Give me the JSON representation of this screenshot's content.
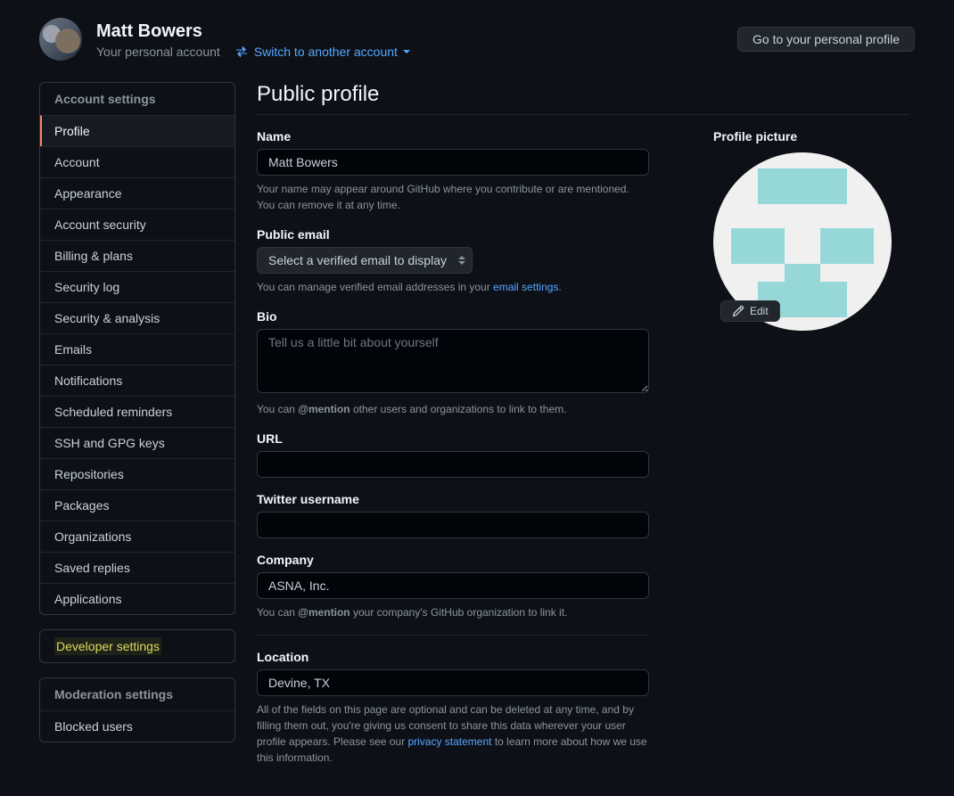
{
  "header": {
    "username": "Matt Bowers",
    "subtitle": "Your personal account",
    "switch_label": "Switch to another account",
    "go_profile_label": "Go to your personal profile"
  },
  "sidebar": {
    "account_settings_header": "Account settings",
    "items": [
      {
        "label": "Profile",
        "active": true
      },
      {
        "label": "Account"
      },
      {
        "label": "Appearance"
      },
      {
        "label": "Account security"
      },
      {
        "label": "Billing & plans"
      },
      {
        "label": "Security log"
      },
      {
        "label": "Security & analysis"
      },
      {
        "label": "Emails"
      },
      {
        "label": "Notifications"
      },
      {
        "label": "Scheduled reminders"
      },
      {
        "label": "SSH and GPG keys"
      },
      {
        "label": "Repositories"
      },
      {
        "label": "Packages"
      },
      {
        "label": "Organizations"
      },
      {
        "label": "Saved replies"
      },
      {
        "label": "Applications"
      }
    ],
    "developer_settings": "Developer settings",
    "moderation_header": "Moderation settings",
    "moderation_items": [
      {
        "label": "Blocked users"
      }
    ]
  },
  "page": {
    "title": "Public profile",
    "name_label": "Name",
    "name_value": "Matt Bowers",
    "name_help": "Your name may appear around GitHub where you contribute or are mentioned. You can remove it at any time.",
    "email_label": "Public email",
    "email_select": "Select a verified email to display",
    "email_help_pre": "You can manage verified email addresses in your ",
    "email_help_link": "email settings",
    "bio_label": "Bio",
    "bio_placeholder": "Tell us a little bit about yourself",
    "bio_help_pre": "You can ",
    "bio_help_strong": "@mention",
    "bio_help_post": " other users and organizations to link to them.",
    "url_label": "URL",
    "twitter_label": "Twitter username",
    "company_label": "Company",
    "company_value": "ASNA, Inc.",
    "company_help_pre": "You can ",
    "company_help_strong": "@mention",
    "company_help_post": " your company's GitHub organization to link it.",
    "location_label": "Location",
    "location_value": "Devine, TX",
    "footer_pre": "All of the fields on this page are optional and can be deleted at any time, and by filling them out, you're giving us consent to share this data wherever your user profile appears. Please see our ",
    "footer_link": "privacy statement",
    "footer_post": " to learn more about how we use this information.",
    "picture_label": "Profile picture",
    "edit_label": "Edit"
  }
}
